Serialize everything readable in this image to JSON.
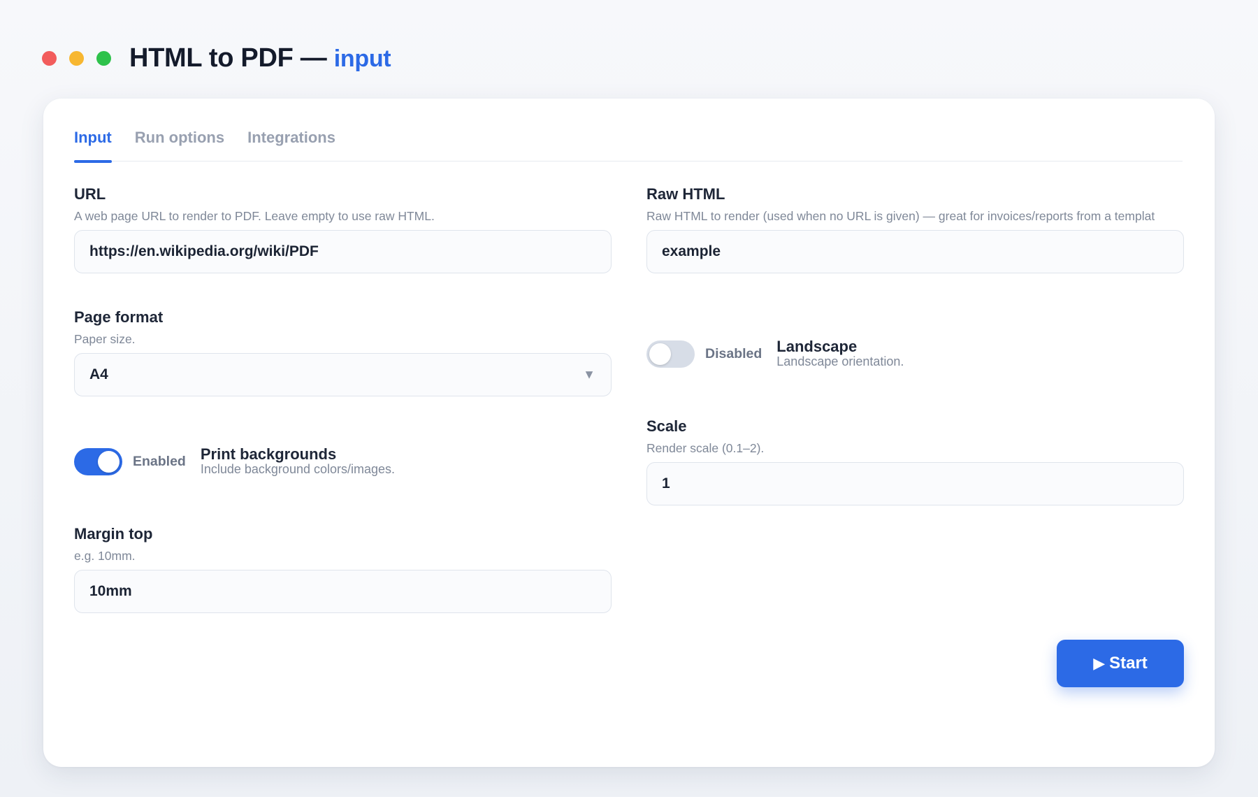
{
  "window": {
    "title": "HTML to PDF —",
    "title_accent": "input",
    "traffic_lights": [
      "#f25c5c",
      "#f7b731",
      "#2ec24b"
    ]
  },
  "tabs": [
    {
      "label": "Input",
      "active": true
    },
    {
      "label": "Run options",
      "active": false
    },
    {
      "label": "Integrations",
      "active": false
    }
  ],
  "fields": {
    "url": {
      "label": "URL",
      "help": "A web page URL to render to PDF. Leave empty to use raw HTML.",
      "value": "https://en.wikipedia.org/wiki/PDF"
    },
    "raw_html": {
      "label": "Raw HTML",
      "help": "Raw HTML to render (used when no URL is given) — great for invoices/reports from a templat",
      "value": "example"
    },
    "page_format": {
      "label": "Page format",
      "help": "Paper size.",
      "value": "A4"
    },
    "landscape": {
      "label": "Landscape",
      "help": "Landscape orientation.",
      "state": "Disabled",
      "enabled": false
    },
    "print_backgrounds": {
      "label": "Print backgrounds",
      "help": "Include background colors/images.",
      "state": "Enabled",
      "enabled": true
    },
    "scale": {
      "label": "Scale",
      "help": "Render scale (0.1–2).",
      "value": "1"
    },
    "margin_top": {
      "label": "Margin top",
      "help": "e.g. 10mm.",
      "value": "10mm"
    }
  },
  "actions": {
    "start_label": "Start",
    "start_icon": "play-icon"
  },
  "colors": {
    "accent": "#2c6ae6",
    "toggle_off": "#d7dde7"
  }
}
